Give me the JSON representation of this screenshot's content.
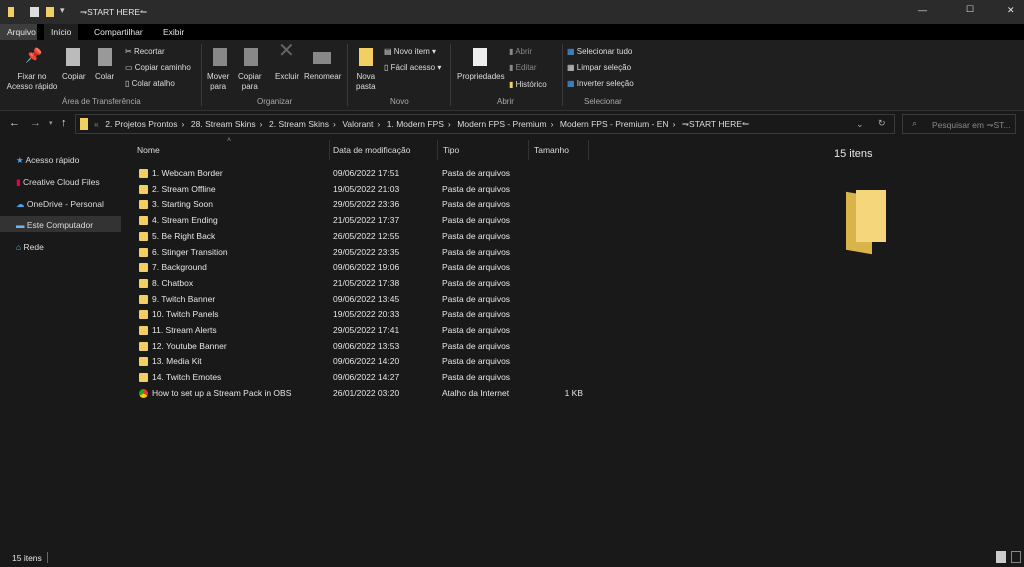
{
  "window": {
    "title": "⇁START HERE↼",
    "minimize": "—",
    "maximize": "☐",
    "close": "✕"
  },
  "ribbon_tabs": [
    "Arquivo",
    "Início",
    "Compartilhar",
    "Exibir"
  ],
  "ribbon": {
    "clipboard": {
      "pin": "Fixar no",
      "pin2": "Acesso rápido",
      "copy": "Copiar",
      "paste": "Colar",
      "cut": "Recortar",
      "copy_path": "Copiar caminho",
      "paste_shortcut": "Colar atalho",
      "label": "Área de Transferência"
    },
    "organize": {
      "move": "Mover",
      "move2": "para",
      "copy": "Copiar",
      "copy2": "para",
      "delete": "Excluir",
      "rename": "Renomear",
      "label": "Organizar"
    },
    "new": {
      "new_folder": "Nova",
      "new_folder2": "pasta",
      "new_item": "Novo item",
      "easy_access": "Fácil acesso",
      "label": "Novo"
    },
    "open": {
      "properties": "Propriedades",
      "open": "Abrir",
      "edit": "Editar",
      "history": "Histórico",
      "label": "Abrir"
    },
    "select": {
      "all": "Selecionar tudo",
      "none": "Limpar seleção",
      "invert": "Inverter seleção",
      "label": "Selecionar"
    }
  },
  "breadcrumb": [
    "2. Projetos Prontos",
    "28. Stream Skins",
    "2. Stream Skins",
    "Valorant",
    "1. Modern FPS",
    "Modern FPS - Premium",
    "Modern FPS - Premium - EN",
    "⇁START HERE↼"
  ],
  "search_placeholder": "Pesquisar em ⇁ST...",
  "sidebar": [
    "Acesso rápido",
    "Creative Cloud Files",
    "OneDrive - Personal",
    "Este Computador",
    "Rede"
  ],
  "columns": [
    "Nome",
    "Data de modificação",
    "Tipo",
    "Tamanho"
  ],
  "files": [
    [
      "1. Webcam Border",
      "09/06/2022 17:51",
      "Pasta de arquivos",
      ""
    ],
    [
      "2. Stream Offline",
      "19/05/2022 21:03",
      "Pasta de arquivos",
      ""
    ],
    [
      "3. Starting Soon",
      "29/05/2022 23:36",
      "Pasta de arquivos",
      ""
    ],
    [
      "4. Stream Ending",
      "21/05/2022 17:37",
      "Pasta de arquivos",
      ""
    ],
    [
      "5. Be Right Back",
      "26/05/2022 12:55",
      "Pasta de arquivos",
      ""
    ],
    [
      "6. Stinger Transition",
      "29/05/2022 23:35",
      "Pasta de arquivos",
      ""
    ],
    [
      "7. Background",
      "09/06/2022 19:06",
      "Pasta de arquivos",
      ""
    ],
    [
      "8. Chatbox",
      "21/05/2022 17:38",
      "Pasta de arquivos",
      ""
    ],
    [
      "9. Twitch Banner",
      "09/06/2022 13:45",
      "Pasta de arquivos",
      ""
    ],
    [
      "10. Twitch Panels",
      "19/05/2022 20:33",
      "Pasta de arquivos",
      ""
    ],
    [
      "11. Stream Alerts",
      "29/05/2022 17:41",
      "Pasta de arquivos",
      ""
    ],
    [
      "12. Youtube Banner",
      "09/06/2022 13:53",
      "Pasta de arquivos",
      ""
    ],
    [
      "13. Media Kit",
      "09/06/2022 14:20",
      "Pasta de arquivos",
      ""
    ],
    [
      "14. Twitch Emotes",
      "09/06/2022 14:27",
      "Pasta de arquivos",
      ""
    ],
    [
      "How to set up a Stream Pack in OBS",
      "26/01/2022 03:20",
      "Atalho da Internet",
      "1 KB"
    ]
  ],
  "preview_count": "15 itens",
  "status": "15 itens"
}
